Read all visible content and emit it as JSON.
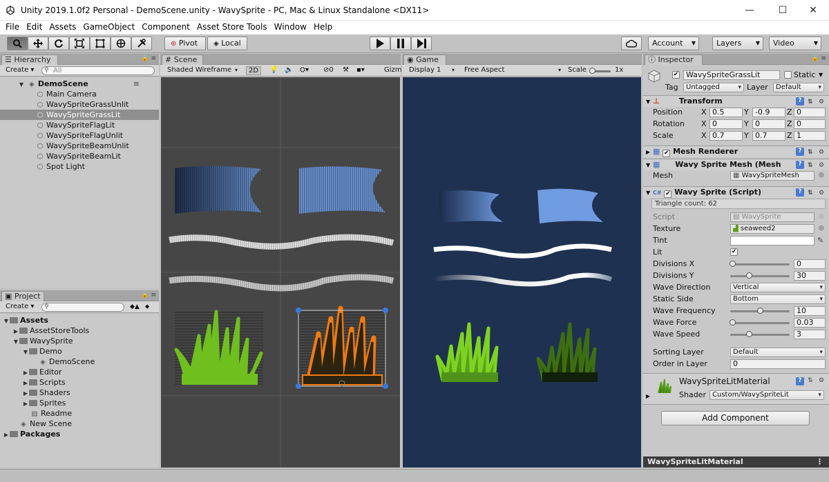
{
  "window": {
    "title": "Unity 2019.1.0f2 Personal - DemoScene.unity - WavySprite - PC, Mac & Linux Standalone <DX11>",
    "controls": [
      "—",
      "☐",
      "✕"
    ]
  },
  "menu": [
    "File",
    "Edit",
    "Assets",
    "GameObject",
    "Component",
    "Asset Store Tools",
    "Window",
    "Help"
  ],
  "toolbar": {
    "pivot": "Pivot",
    "local": "Local",
    "account": "Account",
    "layers": "Layers",
    "layout": "Video"
  },
  "hierarchy": {
    "tab": "Hierarchy",
    "create": "Create",
    "search_placeholder": "All",
    "scene": "DemoScene",
    "items": [
      "Main Camera",
      "WavySpriteGrassUnlit",
      "WavySpriteGrassLit",
      "WavySpriteFlagLit",
      "WavySpriteFlagUnlit",
      "WavySpriteBeamUnlit",
      "WavySpriteBeamLit",
      "Spot Light"
    ],
    "selected": "WavySpriteGrassLit"
  },
  "project": {
    "tab": "Project",
    "create": "Create",
    "items": [
      {
        "label": "Assets",
        "level": 0,
        "kind": "folder",
        "bold": true
      },
      {
        "label": "AssetStoreTools",
        "level": 1,
        "kind": "folder"
      },
      {
        "label": "WavySprite",
        "level": 1,
        "kind": "folder"
      },
      {
        "label": "Demo",
        "level": 2,
        "kind": "folder"
      },
      {
        "label": "DemoScene",
        "level": 3,
        "kind": "scene"
      },
      {
        "label": "Editor",
        "level": 2,
        "kind": "folder"
      },
      {
        "label": "Scripts",
        "level": 2,
        "kind": "folder"
      },
      {
        "label": "Shaders",
        "level": 2,
        "kind": "folder"
      },
      {
        "label": "Sprites",
        "level": 2,
        "kind": "folder"
      },
      {
        "label": "Readme",
        "level": 2,
        "kind": "file"
      },
      {
        "label": "New Scene",
        "level": 1,
        "kind": "scene"
      },
      {
        "label": "Packages",
        "level": 0,
        "kind": "folder",
        "bold": true
      }
    ]
  },
  "scene": {
    "tab": "Scene",
    "shading": "Shaded Wireframe",
    "mode2d": "2D",
    "gizmos": "Gizm"
  },
  "game": {
    "tab": "Game",
    "display": "Display 1",
    "aspect": "Free Aspect",
    "scale_label": "Scale",
    "scale_value": "1x"
  },
  "inspector": {
    "tab": "Inspector",
    "object_name": "WavySpriteGrassLit",
    "static_label": "Static",
    "tag_label": "Tag",
    "tag": "Untagged",
    "layer_label": "Layer",
    "layer": "Default",
    "transform": {
      "title": "Transform",
      "rows": [
        {
          "label": "Position",
          "x": "0.5",
          "y": "-0.9",
          "z": "0"
        },
        {
          "label": "Rotation",
          "x": "0",
          "y": "0",
          "z": "0"
        },
        {
          "label": "Scale",
          "x": "0.7",
          "y": "0.7",
          "z": "1"
        }
      ],
      "axis": [
        "X",
        "Y",
        "Z"
      ]
    },
    "mesh_renderer": "Mesh Renderer",
    "mesh_filter": {
      "title": "Wavy Sprite Mesh (Mesh",
      "mesh_label": "Mesh",
      "mesh": "WavySpriteMesh"
    },
    "wavy": {
      "title": "Wavy Sprite (Script)",
      "info": "Triangle count: 62",
      "script_label": "Script",
      "script": "WavySprite",
      "texture_label": "Texture",
      "texture": "seaweed2",
      "tint_label": "Tint",
      "lit_label": "Lit",
      "div_x_label": "Divisions X",
      "div_x": "0",
      "div_x_level": 0.0,
      "div_y_label": "Divisions Y",
      "div_y": "30",
      "div_y_level": 0.3,
      "wave_dir_label": "Wave Direction",
      "wave_dir": "Vertical",
      "static_side_label": "Static Side",
      "static_side": "Bottom",
      "freq_label": "Wave Frequency",
      "freq": "10",
      "freq_level": 0.5,
      "force_label": "Wave Force",
      "force": "0.03",
      "force_level": 0.0,
      "speed_label": "Wave Speed",
      "speed": "3",
      "speed_level": 0.3,
      "sorting_label": "Sorting Layer",
      "sorting": "Default",
      "order_label": "Order in Layer",
      "order": "0"
    },
    "material": {
      "name": "WavySpriteLitMaterial",
      "shader_label": "Shader",
      "shader": "Custom/WavySpriteLit"
    },
    "add_component": "Add Component",
    "preview_title": "WavySpriteLitMaterial"
  },
  "colors": {
    "accent_selection": "#8f8f8f",
    "game_bg": "#1f3150",
    "scene_bg": "#464646",
    "grass_green": "#6fbf1f",
    "flag_blue": "#6f9be0",
    "selection_orange": "#f07a10"
  }
}
